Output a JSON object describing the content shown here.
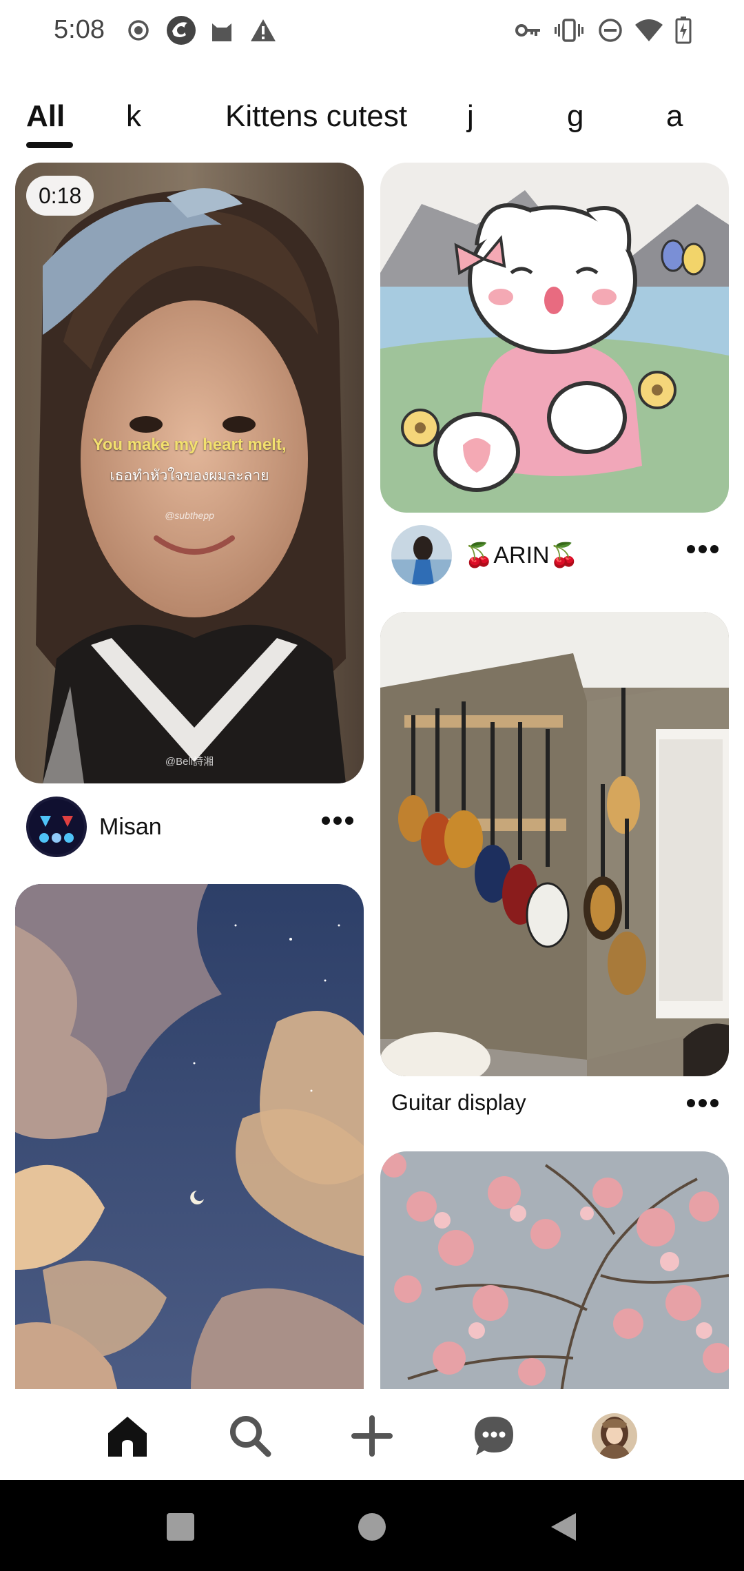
{
  "status_bar": {
    "time": "5:08",
    "left_icons": [
      "record-icon",
      "app-icon",
      "cat-icon",
      "warning-icon"
    ],
    "right_icons": [
      "vpn-key-icon",
      "vibrate-icon",
      "do-not-disturb-icon",
      "wifi-icon",
      "battery-charging-icon"
    ]
  },
  "tabs": {
    "items": [
      {
        "label": "All",
        "selected": true
      },
      {
        "label": "k",
        "selected": false
      },
      {
        "label": "Kittens cutest",
        "selected": false
      },
      {
        "label": "j",
        "selected": false
      },
      {
        "label": "g",
        "selected": false
      },
      {
        "label": "a",
        "selected": false
      }
    ]
  },
  "feed": {
    "video_pin": {
      "duration": "0:18",
      "caption_en": "You make my heart melt,",
      "caption_th": "เธอทำหัวใจของผมละลาย",
      "credit": "@subthepp",
      "credit2": "@Beli詩湘",
      "author": "Misan"
    },
    "kitten_pin": {
      "author": "🍒ARIN🍒"
    },
    "guitar_pin": {
      "title": "Guitar display"
    }
  },
  "bottom_nav": {
    "items": [
      "home-icon",
      "search-icon",
      "plus-icon",
      "chat-icon",
      "profile-avatar"
    ]
  },
  "colors": {
    "text": "#111111",
    "background": "#ffffff",
    "system_nav": "#000000"
  }
}
